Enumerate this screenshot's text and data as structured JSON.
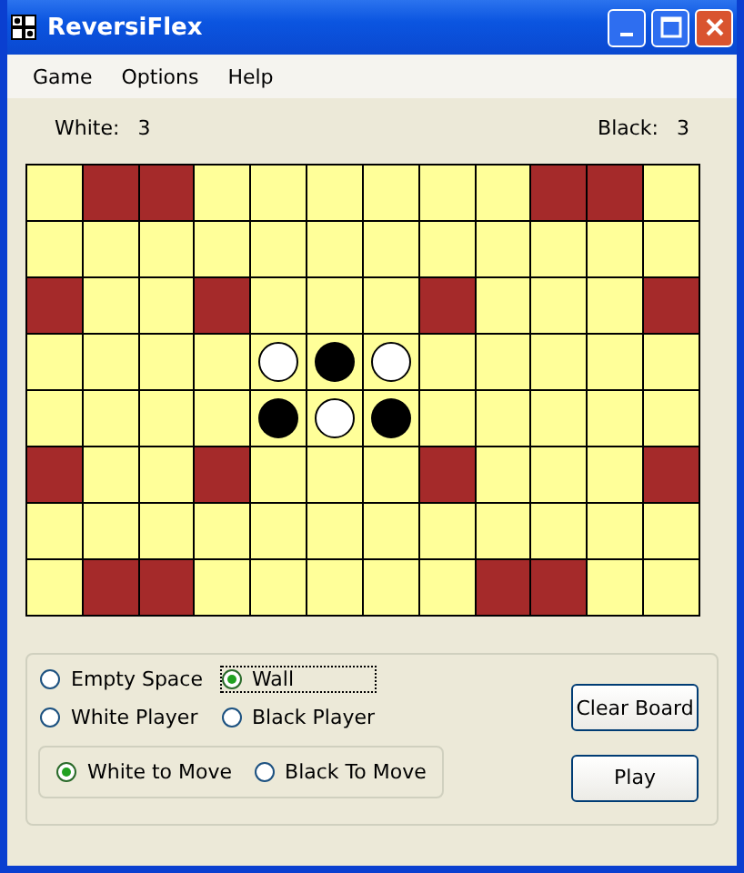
{
  "window": {
    "title": "ReversiFlex"
  },
  "menu": [
    "Game",
    "Options",
    "Help"
  ],
  "scores": [
    {
      "label": "White:",
      "value": "3"
    },
    {
      "label": "Black:",
      "value": "3"
    }
  ],
  "board": {
    "rows": [
      {
        "cells": [
          {
            "kind": "empty"
          },
          {
            "kind": "wall"
          },
          {
            "kind": "wall"
          },
          {
            "kind": "empty"
          },
          {
            "kind": "empty"
          },
          {
            "kind": "empty"
          },
          {
            "kind": "empty"
          },
          {
            "kind": "empty"
          },
          {
            "kind": "empty"
          },
          {
            "kind": "wall"
          },
          {
            "kind": "wall"
          },
          {
            "kind": "empty"
          }
        ]
      },
      {
        "cells": [
          {
            "kind": "empty"
          },
          {
            "kind": "empty"
          },
          {
            "kind": "empty"
          },
          {
            "kind": "empty"
          },
          {
            "kind": "empty"
          },
          {
            "kind": "empty"
          },
          {
            "kind": "empty"
          },
          {
            "kind": "empty"
          },
          {
            "kind": "empty"
          },
          {
            "kind": "empty"
          },
          {
            "kind": "empty"
          },
          {
            "kind": "empty"
          }
        ]
      },
      {
        "cells": [
          {
            "kind": "wall"
          },
          {
            "kind": "empty"
          },
          {
            "kind": "empty"
          },
          {
            "kind": "wall"
          },
          {
            "kind": "empty"
          },
          {
            "kind": "empty"
          },
          {
            "kind": "empty"
          },
          {
            "kind": "wall"
          },
          {
            "kind": "empty"
          },
          {
            "kind": "empty"
          },
          {
            "kind": "empty"
          },
          {
            "kind": "wall"
          }
        ]
      },
      {
        "cells": [
          {
            "kind": "empty"
          },
          {
            "kind": "empty"
          },
          {
            "kind": "empty"
          },
          {
            "kind": "empty"
          },
          {
            "kind": "white"
          },
          {
            "kind": "black"
          },
          {
            "kind": "white"
          },
          {
            "kind": "empty"
          },
          {
            "kind": "empty"
          },
          {
            "kind": "empty"
          },
          {
            "kind": "empty"
          },
          {
            "kind": "empty"
          }
        ]
      },
      {
        "cells": [
          {
            "kind": "empty"
          },
          {
            "kind": "empty"
          },
          {
            "kind": "empty"
          },
          {
            "kind": "empty"
          },
          {
            "kind": "black"
          },
          {
            "kind": "white"
          },
          {
            "kind": "black"
          },
          {
            "kind": "empty"
          },
          {
            "kind": "empty"
          },
          {
            "kind": "empty"
          },
          {
            "kind": "empty"
          },
          {
            "kind": "empty"
          }
        ]
      },
      {
        "cells": [
          {
            "kind": "wall"
          },
          {
            "kind": "empty"
          },
          {
            "kind": "empty"
          },
          {
            "kind": "wall"
          },
          {
            "kind": "empty"
          },
          {
            "kind": "empty"
          },
          {
            "kind": "empty"
          },
          {
            "kind": "wall"
          },
          {
            "kind": "empty"
          },
          {
            "kind": "empty"
          },
          {
            "kind": "empty"
          },
          {
            "kind": "wall"
          }
        ]
      },
      {
        "cells": [
          {
            "kind": "empty"
          },
          {
            "kind": "empty"
          },
          {
            "kind": "empty"
          },
          {
            "kind": "empty"
          },
          {
            "kind": "empty"
          },
          {
            "kind": "empty"
          },
          {
            "kind": "empty"
          },
          {
            "kind": "empty"
          },
          {
            "kind": "empty"
          },
          {
            "kind": "empty"
          },
          {
            "kind": "empty"
          },
          {
            "kind": "empty"
          }
        ]
      },
      {
        "cells": [
          {
            "kind": "empty"
          },
          {
            "kind": "wall"
          },
          {
            "kind": "wall"
          },
          {
            "kind": "empty"
          },
          {
            "kind": "empty"
          },
          {
            "kind": "empty"
          },
          {
            "kind": "empty"
          },
          {
            "kind": "empty"
          },
          {
            "kind": "wall"
          },
          {
            "kind": "wall"
          },
          {
            "kind": "empty"
          },
          {
            "kind": "empty"
          }
        ]
      }
    ]
  },
  "piece_options": [
    {
      "label": "Empty Space",
      "selected": false
    },
    {
      "label": "Wall",
      "selected": true
    },
    {
      "label": "White Player",
      "selected": false
    },
    {
      "label": "Black Player",
      "selected": false
    }
  ],
  "turn_options": [
    {
      "label": "White to Move",
      "selected": true
    },
    {
      "label": "Black To Move",
      "selected": false
    }
  ],
  "buttons": [
    "Clear Board",
    "Play"
  ]
}
